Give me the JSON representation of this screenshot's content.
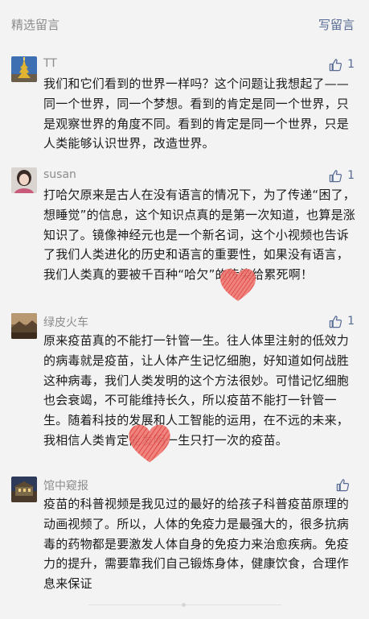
{
  "header": {
    "title": "精选留言",
    "write_label": "写留言"
  },
  "comments": [
    {
      "nickname": "TT",
      "avatar_icon": "golden-pagoda-avatar",
      "likes": "1",
      "text": "我们和它们看到的世界一样吗？这个问题让我想起了——同一个世界，同一个梦想。看到的肯定是同一个世界，只是观察世界的角度不同。看到的肯定是同一个世界，只是人类能够认识世界，改造世界。"
    },
    {
      "nickname": "susan",
      "avatar_icon": "woman-portrait-avatar",
      "likes": "1",
      "text": "打哈欠原来是古人在没有语言的情况下，为了传递“困了，想睡觉”的信息，这个知识点真的是第一次知道，也算是涨知识了。镜像神经元也是一个新名词，这个小视频也告诉了我们人类进化的历史和语言的重要性，如果没有语言，我们人类真的要被千百种“哈欠”的传染给累死啊！"
    },
    {
      "nickname": "绿皮火车",
      "avatar_icon": "landscape-avatar",
      "likes": "1",
      "text": "原来疫苗真的不能打一针管一生。往人体里注射的低效力的病毒就是疫苗，让人体产生记忆细胞，好知道如何战胜这种病毒，我们人类发明的这个方法很妙。可惜记忆细胞也会衰竭，不可能维持长久，所以疫苗不能打一针管一生。随着科技的发展和人工智能的运用，在不远的未来，我相信人类肯定能发明一生只打一次的疫苗。"
    },
    {
      "nickname": "馆中窥报",
      "avatar_icon": "building-night-avatar",
      "likes": "",
      "text": "疫苗的科普视频是我见过的最好的给孩子科普疫苗原理的动画视频了。所以，人体的免疫力是最强大的，很多抗病毒的药物都是要激发人体自身的免疫力来治愈疾病。免疫力的提升，需要靠我们自己锻炼身体，健康饮食，合理作息来保证"
    }
  ],
  "colors": {
    "background": "#f3f3f3",
    "link": "#576b95",
    "meta": "#8c8c8c",
    "text": "#1a1a1a",
    "heart": "#e8514f"
  }
}
